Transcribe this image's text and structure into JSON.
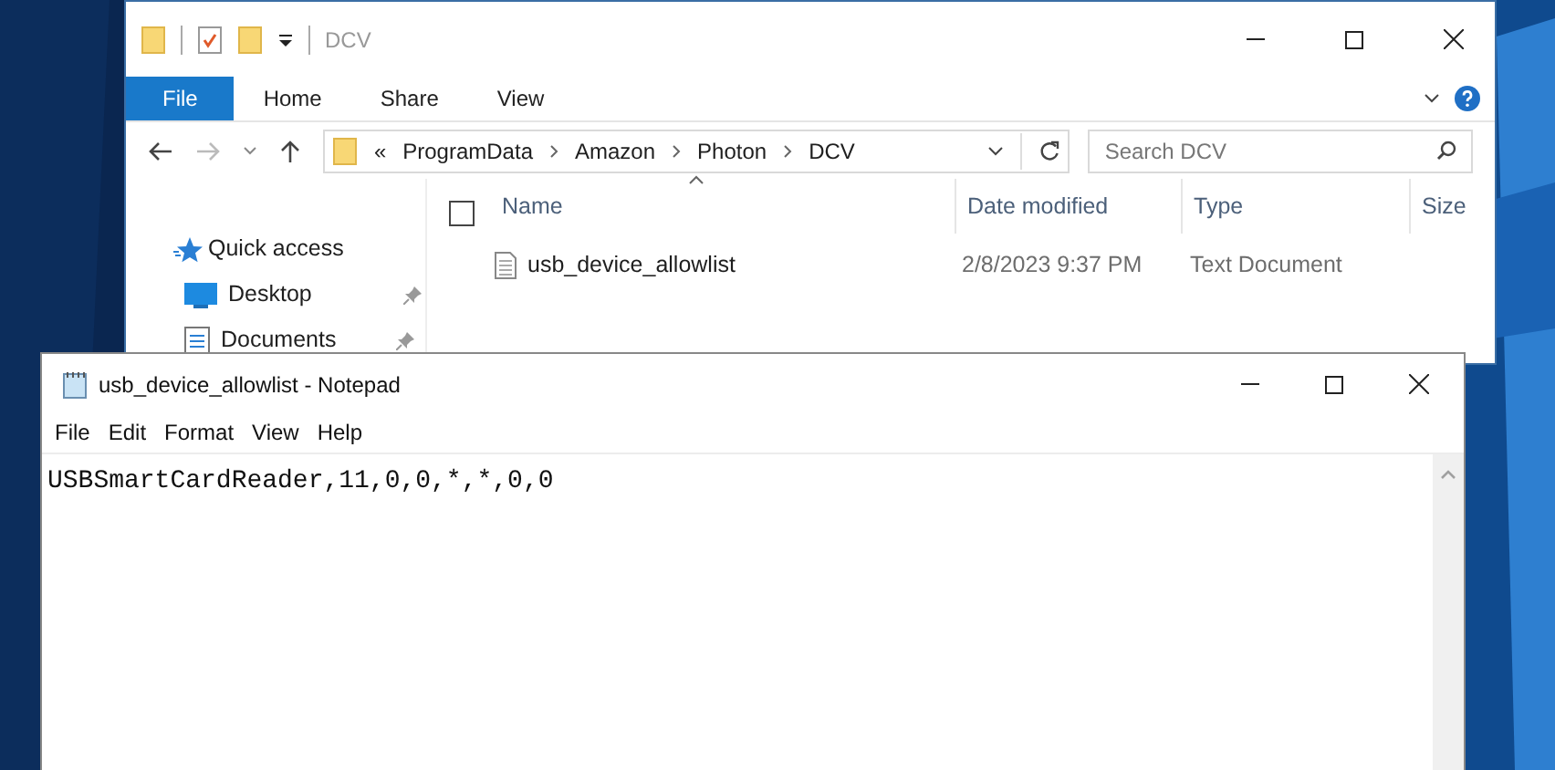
{
  "explorer": {
    "title": "DCV",
    "ribbon_tabs": [
      {
        "label": "File",
        "selected": true
      },
      {
        "label": "Home",
        "selected": false
      },
      {
        "label": "Share",
        "selected": false
      },
      {
        "label": "View",
        "selected": false
      }
    ],
    "address": {
      "overflow": "«",
      "segments": [
        "ProgramData",
        "Amazon",
        "Photon",
        "DCV"
      ]
    },
    "search": {
      "placeholder": "Search DCV"
    },
    "nav_items": [
      {
        "label": "Quick access",
        "kind": "star",
        "pinned": false
      },
      {
        "label": "Desktop",
        "kind": "desktop",
        "pinned": true
      },
      {
        "label": "Documents",
        "kind": "documents",
        "pinned": true
      }
    ],
    "select_all": {
      "checked": false
    },
    "columns": [
      "Name",
      "Date modified",
      "Type",
      "Size"
    ],
    "files": [
      {
        "name": "usb_device_allowlist",
        "date_modified": "2/8/2023 9:37 PM",
        "type": "Text Document"
      }
    ]
  },
  "notepad": {
    "title": "usb_device_allowlist - Notepad",
    "menu": [
      "File",
      "Edit",
      "Format",
      "View",
      "Help"
    ],
    "content": "USBSmartCardReader,11,0,0,*,*,0,0"
  }
}
